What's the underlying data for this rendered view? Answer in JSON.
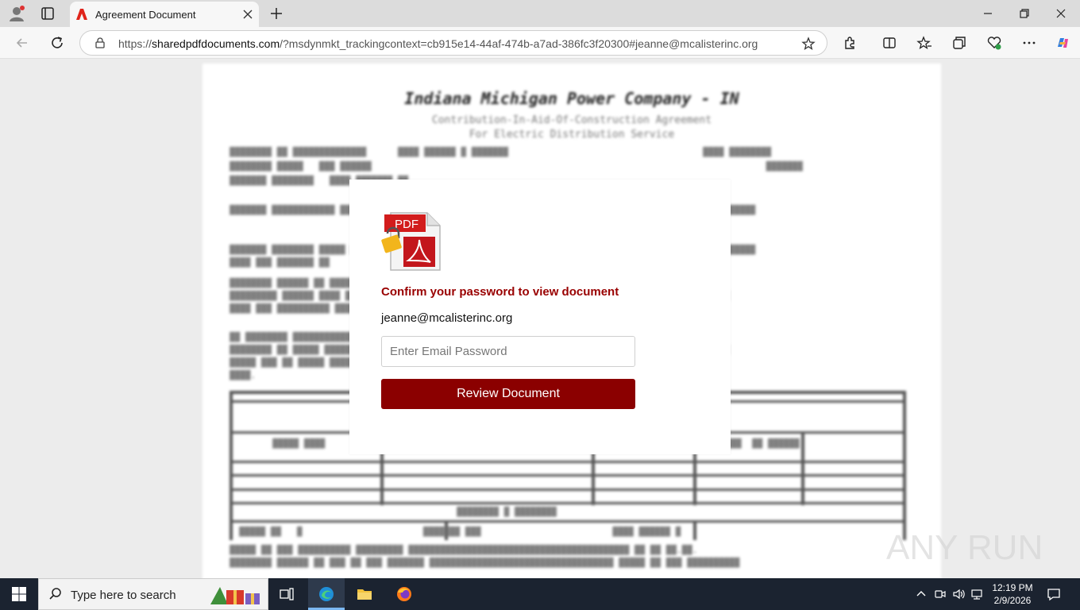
{
  "browser": {
    "tab_title": "Agreement Document",
    "url_prefix": "https://",
    "url_domain": "sharedpdfdocuments.com",
    "url_rest": "/?msdynmkt_trackingcontext=cb915e14-44af-474b-a7ad-386fc3f20300#jeanne@mcalisterinc.org"
  },
  "modal": {
    "logo_text": "PDF",
    "title": "Confirm your password to view document",
    "email": "jeanne@mcalisterinc.org",
    "password_placeholder": "Enter Email Password",
    "submit_label": "Review Document"
  },
  "document_background": {
    "heading": "Indiana Michigan Power Company - IN",
    "subheading_1": "Contribution-In-Aid-Of-Construction Agreement",
    "subheading_2": "For Electric Distribution Service"
  },
  "watermark": "ANY RUN",
  "taskbar": {
    "search_placeholder": "Type here to search",
    "time": "12:19 PM",
    "date": "2/9/2026"
  },
  "colors": {
    "accent_red": "#8b0000",
    "title_red": "#990000"
  }
}
